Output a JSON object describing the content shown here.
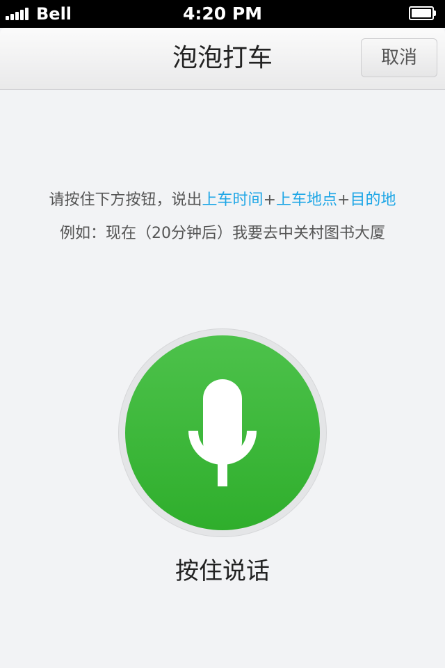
{
  "status_bar": {
    "carrier": "Bell",
    "time": "4:20 PM",
    "signal_icon": "signal-bars-icon",
    "battery_icon": "battery-icon",
    "battery_level": 1.0
  },
  "nav": {
    "title": "泡泡打车",
    "cancel_label": "取消"
  },
  "instructions": {
    "line1_prefix": "请按住下方按钮，说出",
    "line1_time": "上车时间",
    "plus1": "+",
    "line1_place": "上车地点",
    "plus2": "+",
    "line1_dest": "目的地",
    "line2": "例如：现在（20分钟后）我要去中关村图书大厦"
  },
  "mic": {
    "icon": "microphone-icon",
    "label": "按住说话"
  },
  "colors": {
    "highlight": "#1ea6e6",
    "mic_green": "#3bb838",
    "background": "#f2f3f5"
  }
}
